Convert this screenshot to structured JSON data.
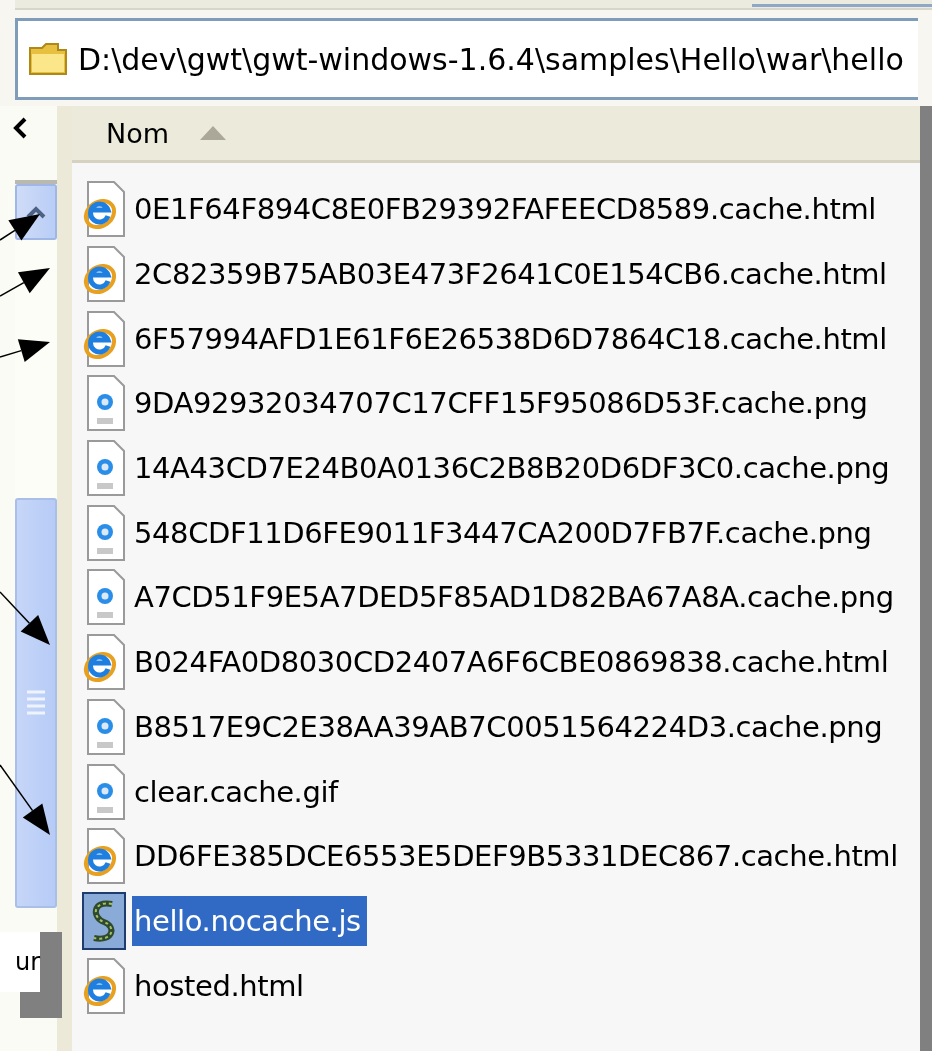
{
  "address_bar": {
    "path": "D:\\dev\\gwt\\gwt-windows-1.6.4\\samples\\Hello\\war\\hello"
  },
  "side_pane": {
    "label": "ur"
  },
  "file_list": {
    "columns": [
      {
        "label": "Nom",
        "sorted": true
      }
    ],
    "files": [
      {
        "name": "0E1F64F894C8E0FB29392FAFEECD8589.cache.html",
        "kind": "html",
        "selected": false
      },
      {
        "name": "2C82359B75AB03E473F2641C0E154CB6.cache.html",
        "kind": "html",
        "selected": false
      },
      {
        "name": "6F57994AFD1E61F6E26538D6D7864C18.cache.html",
        "kind": "html",
        "selected": false
      },
      {
        "name": "9DA92932034707C17CFF15F95086D53F.cache.png",
        "kind": "image",
        "selected": false
      },
      {
        "name": "14A43CD7E24B0A0136C2B8B20D6DF3C0.cache.png",
        "kind": "image",
        "selected": false
      },
      {
        "name": "548CDF11D6FE9011F3447CA200D7FB7F.cache.png",
        "kind": "image",
        "selected": false
      },
      {
        "name": "A7CD51F9E5A7DED5F85AD1D82BA67A8A.cache.png",
        "kind": "image",
        "selected": false
      },
      {
        "name": "B024FA0D8030CD2407A6F6CBE0869838.cache.html",
        "kind": "html",
        "selected": false
      },
      {
        "name": "B8517E9C2E38AA39AB7C0051564224D3.cache.png",
        "kind": "image",
        "selected": false
      },
      {
        "name": "clear.cache.gif",
        "kind": "image",
        "selected": false
      },
      {
        "name": "DD6FE385DCE6553E5DEF9B5331DEC867.cache.html",
        "kind": "html",
        "selected": false
      },
      {
        "name": "hello.nocache.js",
        "kind": "script",
        "selected": true
      },
      {
        "name": "hosted.html",
        "kind": "html",
        "selected": false
      }
    ]
  }
}
